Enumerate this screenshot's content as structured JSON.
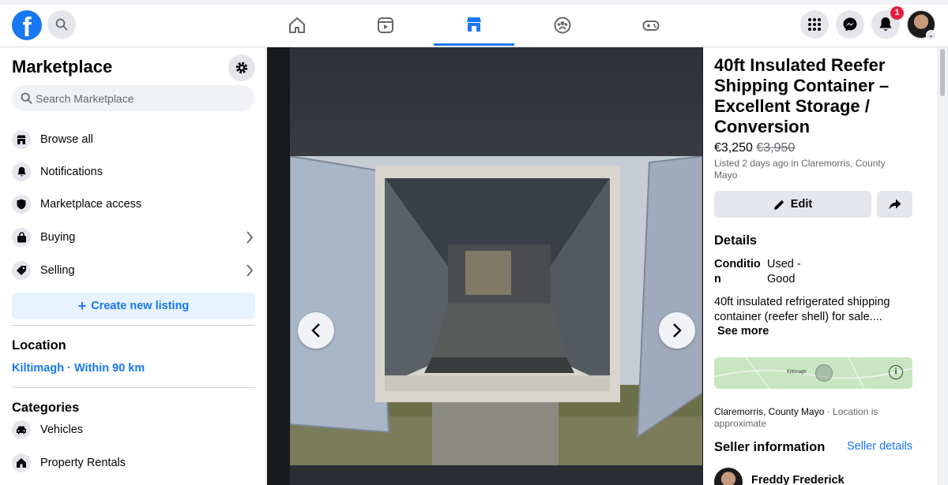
{
  "header": {
    "logo": "f",
    "notification_count": "1",
    "tabs": [
      {
        "name": "home-icon"
      },
      {
        "name": "video-icon"
      },
      {
        "name": "marketplace-icon",
        "active": true
      },
      {
        "name": "groups-icon"
      },
      {
        "name": "gaming-icon"
      }
    ],
    "right_icons": [
      "menu-grid-icon",
      "messenger-icon",
      "bell-icon"
    ]
  },
  "sidebar": {
    "title": "Marketplace",
    "search_placeholder": "Search Marketplace",
    "items": [
      {
        "label": "Browse all",
        "icon": "store-icon"
      },
      {
        "label": "Notifications",
        "icon": "bell-icon"
      },
      {
        "label": "Marketplace access",
        "icon": "shield-icon"
      },
      {
        "label": "Buying",
        "icon": "shopping-bag-icon"
      },
      {
        "label": "Selling",
        "icon": "tag-icon"
      }
    ],
    "create_listing_label": "Create new listing",
    "location_heading": "Location",
    "location_value": "Kiltimagh · Within 90 km",
    "categories_heading": "Categories",
    "categories": [
      {
        "label": "Vehicles",
        "icon": "car-icon"
      },
      {
        "label": "Property Rentals",
        "icon": "house-icon"
      }
    ]
  },
  "listing": {
    "title": "40ft Insulated Reefer Shipping Container – Excellent Storage / Conversion",
    "price": "€3,250",
    "original_price": "€3,950",
    "listed_info": "Listed 2 days ago in Claremorris, County Mayo",
    "edit_label": "Edit",
    "details_heading": "Details",
    "condition_label": "Condition",
    "condition_value": "Used - Good",
    "description": "40ft insulated refrigerated shipping container (reefer shell) for sale....",
    "see_more_label": "See more",
    "map_town_label": "Kiltimagh",
    "location_town": "Claremorris, County Mayo",
    "location_note": " · Location is approximate",
    "seller_heading": "Seller information",
    "seller_details_label": "Seller details",
    "seller_name": "Freddy Frederick"
  },
  "colors": {
    "brand_blue": "#1877f2",
    "badge_red": "#e41e3f",
    "button_gray": "#e4e6eb"
  }
}
